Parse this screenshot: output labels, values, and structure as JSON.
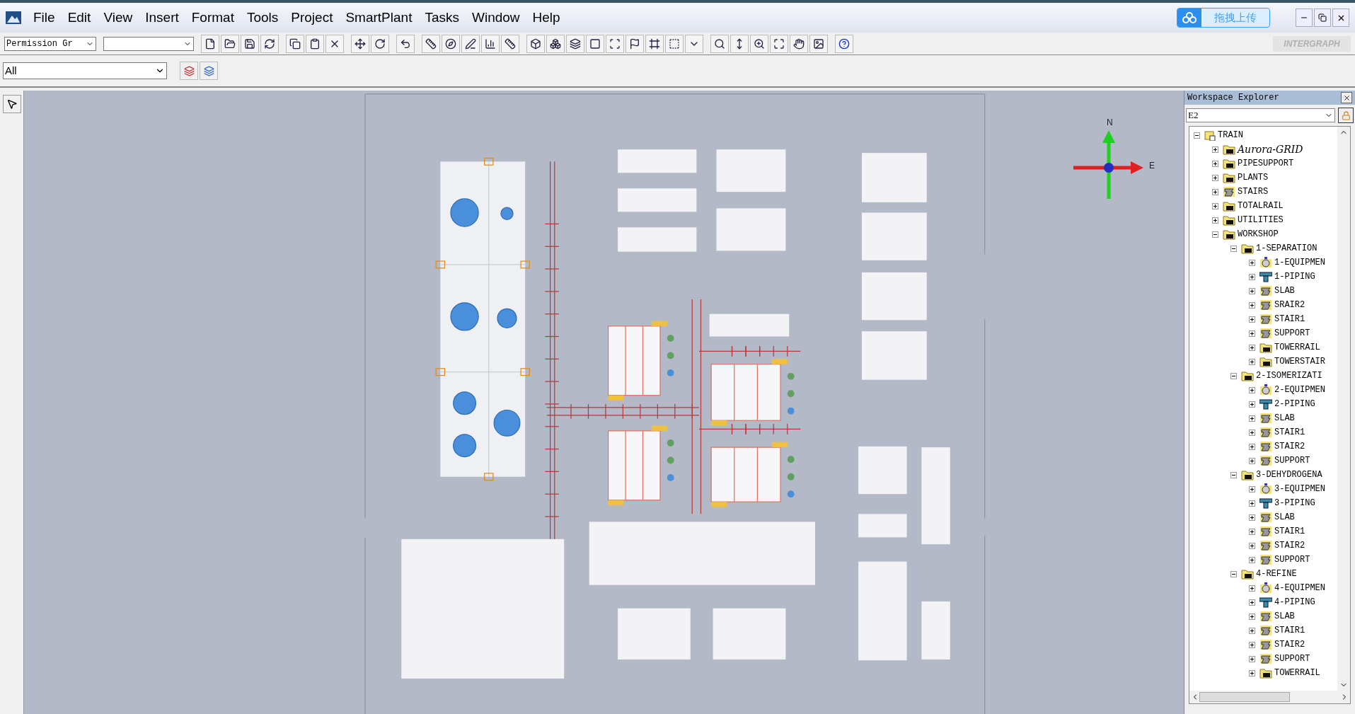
{
  "menu": [
    "File",
    "Edit",
    "View",
    "Insert",
    "Format",
    "Tools",
    "Project",
    "SmartPlant",
    "Tasks",
    "Window",
    "Help"
  ],
  "upload_button": "拖拽上传",
  "logo": "INTERGRAPH",
  "toolbar": {
    "permission_group": "Permission Gr"
  },
  "filter": {
    "value": "All"
  },
  "compass": {
    "north": "N",
    "east": "E"
  },
  "workspace_explorer": {
    "title": "Workspace Explorer",
    "filter": "E2",
    "tree": [
      {
        "label": "TRAIN",
        "kind": "root",
        "italic": false,
        "expanded": true,
        "children": [
          {
            "label": "Aurora-GRID",
            "kind": "folder",
            "italic": true,
            "expanded": false
          },
          {
            "label": "PIPESUPPORT",
            "kind": "folder",
            "italic": false,
            "expanded": false
          },
          {
            "label": "PLANTS",
            "kind": "folder",
            "italic": false,
            "expanded": false
          },
          {
            "label": "STAIRS",
            "kind": "structure",
            "italic": false,
            "expanded": false
          },
          {
            "label": "TOTALRAIL",
            "kind": "folder",
            "italic": false,
            "expanded": false
          },
          {
            "label": "UTILITIES",
            "kind": "folder",
            "italic": false,
            "expanded": false
          },
          {
            "label": "WORKSHOP",
            "kind": "folder",
            "italic": false,
            "expanded": true,
            "children": [
              {
                "label": "1-SEPARATION",
                "kind": "folder",
                "italic": false,
                "expanded": true,
                "children": [
                  {
                    "label": "1-EQUIPMEN",
                    "kind": "equipment",
                    "italic": false,
                    "expanded": false
                  },
                  {
                    "label": "1-PIPING",
                    "kind": "piping",
                    "italic": false,
                    "expanded": false
                  },
                  {
                    "label": "SLAB",
                    "kind": "structure",
                    "italic": false,
                    "expanded": false
                  },
                  {
                    "label": "SRAIR2",
                    "kind": "structure",
                    "italic": false,
                    "expanded": false
                  },
                  {
                    "label": "STAIR1",
                    "kind": "structure",
                    "italic": false,
                    "expanded": false
                  },
                  {
                    "label": "SUPPORT",
                    "kind": "structure",
                    "italic": false,
                    "expanded": false
                  },
                  {
                    "label": "TOWERRAIL",
                    "kind": "folder",
                    "italic": false,
                    "expanded": false
                  },
                  {
                    "label": "TOWERSTAIR",
                    "kind": "folder",
                    "italic": false,
                    "expanded": false
                  }
                ]
              },
              {
                "label": "2-ISOMERIZATI",
                "kind": "folder",
                "italic": false,
                "expanded": true,
                "children": [
                  {
                    "label": "2-EQUIPMEN",
                    "kind": "equipment",
                    "italic": false,
                    "expanded": false
                  },
                  {
                    "label": "2-PIPING",
                    "kind": "piping",
                    "italic": false,
                    "expanded": false
                  },
                  {
                    "label": "SLAB",
                    "kind": "structure",
                    "italic": false,
                    "expanded": false
                  },
                  {
                    "label": "STAIR1",
                    "kind": "structure",
                    "italic": false,
                    "expanded": false
                  },
                  {
                    "label": "STAIR2",
                    "kind": "structure",
                    "italic": false,
                    "expanded": false
                  },
                  {
                    "label": "SUPPORT",
                    "kind": "structure",
                    "italic": false,
                    "expanded": false
                  }
                ]
              },
              {
                "label": "3-DEHYDROGENA",
                "kind": "folder",
                "italic": false,
                "expanded": true,
                "children": [
                  {
                    "label": "3-EQUIPMEN",
                    "kind": "equipment",
                    "italic": false,
                    "expanded": false
                  },
                  {
                    "label": "3-PIPING",
                    "kind": "piping",
                    "italic": false,
                    "expanded": false
                  },
                  {
                    "label": "SLAB",
                    "kind": "structure",
                    "italic": false,
                    "expanded": false
                  },
                  {
                    "label": "STAIR1",
                    "kind": "structure",
                    "italic": false,
                    "expanded": false
                  },
                  {
                    "label": "STAIR2",
                    "kind": "structure",
                    "italic": false,
                    "expanded": false
                  },
                  {
                    "label": "SUPPORT",
                    "kind": "structure",
                    "italic": false,
                    "expanded": false
                  }
                ]
              },
              {
                "label": "4-REFINE",
                "kind": "folder",
                "italic": false,
                "expanded": true,
                "children": [
                  {
                    "label": "4-EQUIPMEN",
                    "kind": "equipment",
                    "italic": false,
                    "expanded": false
                  },
                  {
                    "label": "4-PIPING",
                    "kind": "piping",
                    "italic": false,
                    "expanded": false
                  },
                  {
                    "label": "SLAB",
                    "kind": "structure",
                    "italic": false,
                    "expanded": false
                  },
                  {
                    "label": "STAIR1",
                    "kind": "structure",
                    "italic": false,
                    "expanded": false
                  },
                  {
                    "label": "STAIR2",
                    "kind": "structure",
                    "italic": false,
                    "expanded": false
                  },
                  {
                    "label": "SUPPORT",
                    "kind": "structure",
                    "italic": false,
                    "expanded": false
                  },
                  {
                    "label": "TOWERRAIL",
                    "kind": "folder",
                    "italic": false,
                    "expanded": false
                  }
                ]
              }
            ]
          }
        ]
      }
    ]
  }
}
